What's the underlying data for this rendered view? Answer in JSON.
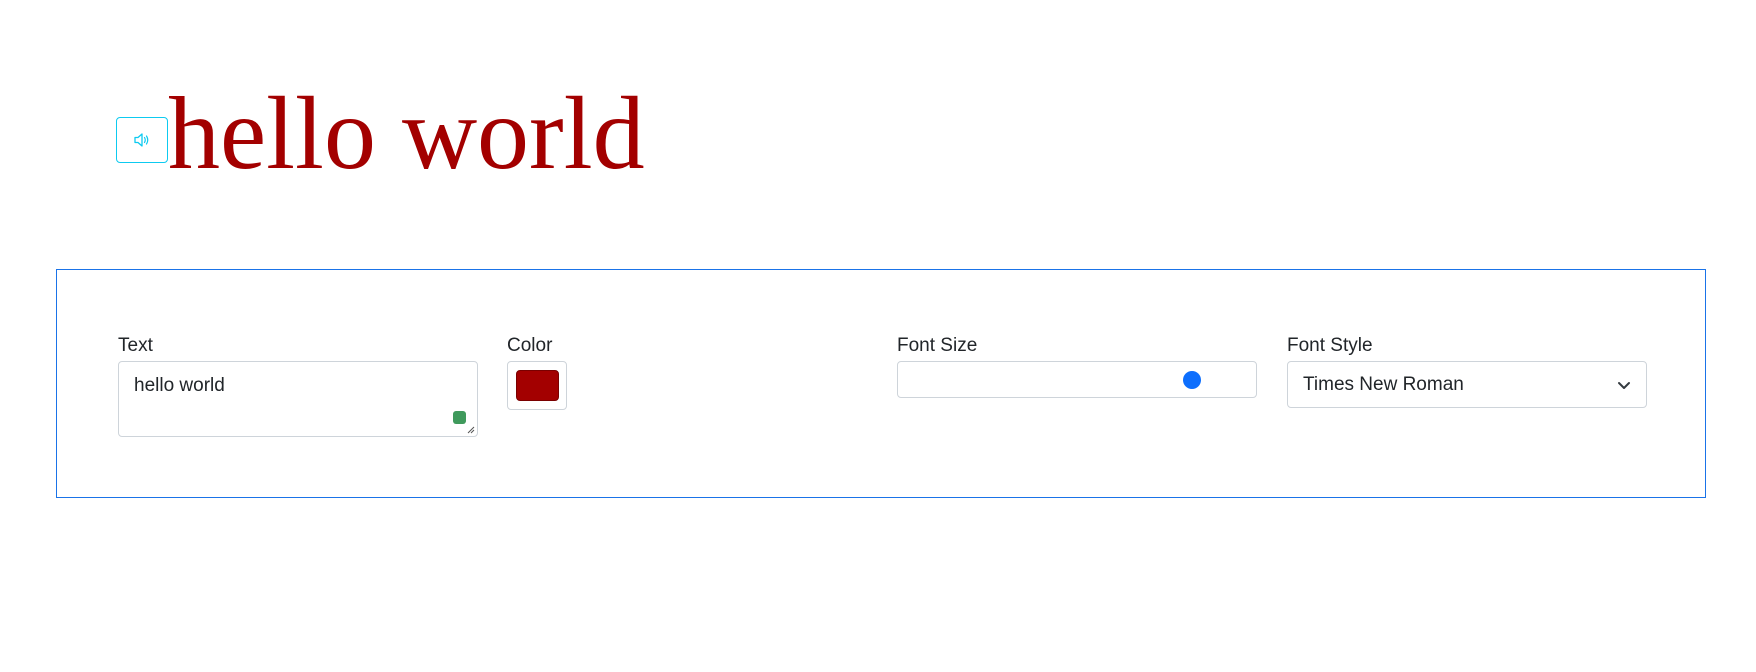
{
  "preview": {
    "text": "hello world",
    "text_color": "#a30000",
    "speak_icon": "speaker-volume-icon",
    "speak_button_color": "#0dcaf0"
  },
  "settings": {
    "text_field": {
      "label": "Text",
      "value": "hello world",
      "badge_icon": "grammar-check-badge-icon",
      "badge_color": "#3f9a5c"
    },
    "color_field": {
      "label": "Color",
      "value": "#a30000"
    },
    "font_size_field": {
      "label": "Font Size",
      "level_fraction": 0.82,
      "thumb_color": "#0d6efd"
    },
    "font_style_field": {
      "label": "Font Style",
      "selected": "Times New Roman",
      "icon": "chevron-down-icon"
    },
    "panel_border_color": "#1a73e8"
  }
}
